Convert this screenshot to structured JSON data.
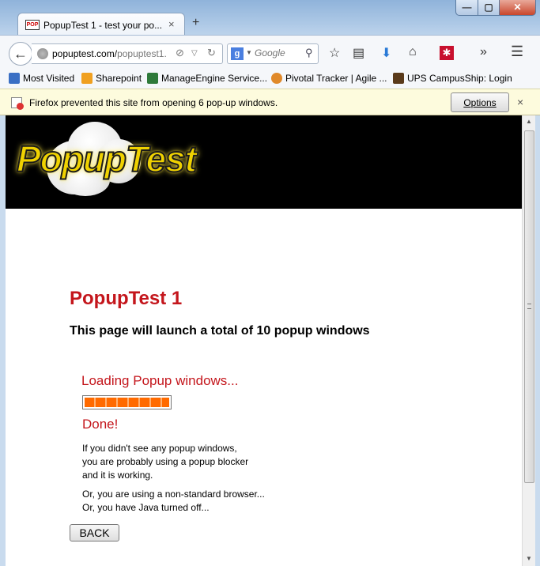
{
  "window": {
    "min_glyph": "—",
    "max_glyph": "▢",
    "close_glyph": "✕"
  },
  "tab": {
    "favicon_text": "POP",
    "title": "PopupTest 1 - test your po...",
    "close_glyph": "×",
    "new_tab_glyph": "+"
  },
  "nav": {
    "back_glyph": "←",
    "url_host": "popuptest.com/",
    "url_path": "popuptest1.",
    "search_engine_glyph": "g",
    "search_placeholder": "Google"
  },
  "bookmarks": [
    {
      "label": "Most Visited",
      "color": "#3a6fc4"
    },
    {
      "label": "Sharepoint",
      "color": "#f0a020"
    },
    {
      "label": "ManageEngine Service...",
      "color": "#2f7a3a"
    },
    {
      "label": "Pivotal Tracker | Agile ...",
      "color": "#e0892a"
    },
    {
      "label": "UPS CampusShip: Login",
      "color": "#5a3a1a"
    }
  ],
  "notification": {
    "message": "Firefox prevented this site from opening 6 pop-up windows.",
    "options_label": "Options",
    "close_glyph": "×"
  },
  "page": {
    "logo_text": "PopupTest",
    "title": "PopupTest 1",
    "subtitle": "This page will launch a total of 10 popup windows",
    "loading_text": "Loading Popup windows...",
    "progress": 1.0,
    "done_text": "Done!",
    "para1": [
      "If you didn't see any popup windows,",
      "you are probably using a popup blocker",
      "and it is working."
    ],
    "para2": [
      "Or, you are using a non-standard browser...",
      "Or, you have Java turned off..."
    ],
    "back_label": "BACK"
  },
  "colors": {
    "accent_red": "#c4161c",
    "progress_orange": "#ff6a00",
    "logo_yellow": "#f0d200"
  }
}
